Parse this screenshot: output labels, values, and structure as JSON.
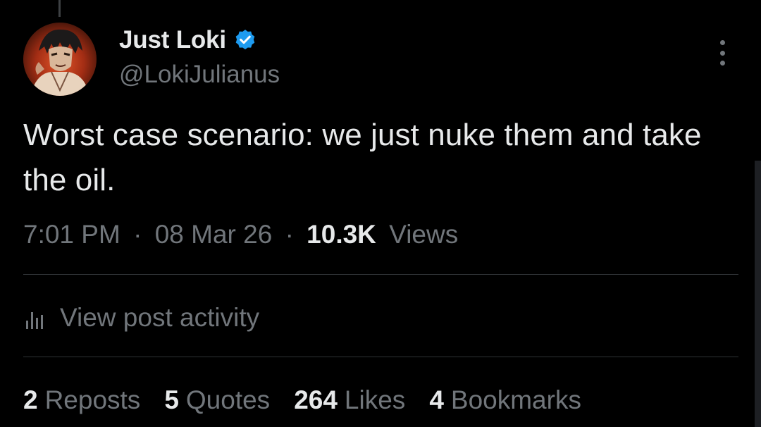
{
  "post": {
    "author": {
      "display_name": "Just Loki",
      "handle": "@LokiJulianus",
      "verified": true,
      "verified_color": "#1d9bf0"
    },
    "text": "Worst case scenario: we just nuke them and take the oil.",
    "meta": {
      "time": "7:01 PM",
      "separator": "·",
      "date": "08 Mar 26",
      "views_count": "10.3K",
      "views_label": "Views"
    },
    "activity_label": "View post activity",
    "stats": [
      {
        "count": "2",
        "label": "Reposts"
      },
      {
        "count": "5",
        "label": "Quotes"
      },
      {
        "count": "264",
        "label": "Likes"
      },
      {
        "count": "4",
        "label": "Bookmarks"
      }
    ]
  },
  "icons": {
    "more": "more-vertical-icon",
    "verified": "verified-badge-icon",
    "activity": "bar-chart-icon"
  },
  "colors": {
    "background": "#000000",
    "primary_text": "#e7e9ea",
    "secondary_text": "#71767b",
    "divider": "#2f3336",
    "accent": "#1d9bf0"
  }
}
